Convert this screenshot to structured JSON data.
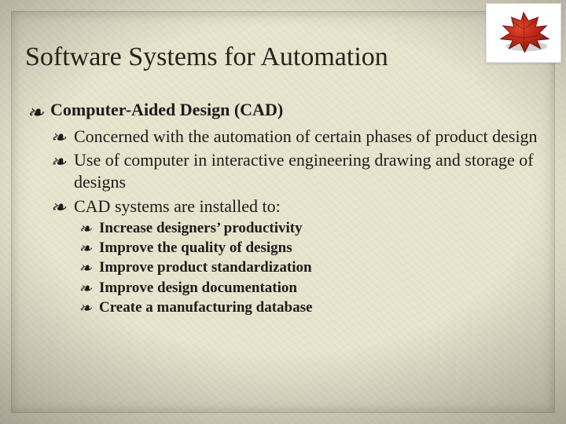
{
  "slide": {
    "title": "Software Systems for Automation",
    "decor_icon_name": "maple-leaf-icon",
    "bullets_l1": [
      {
        "text": "Computer-Aided Design (CAD)"
      }
    ],
    "bullets_l2": [
      {
        "text": "Concerned with the automation of certain phases of product design"
      },
      {
        "text": "Use of computer in interactive engineering drawing and storage of designs"
      },
      {
        "text": "CAD systems are installed to:"
      }
    ],
    "bullets_l3": [
      {
        "text": "Increase designers’ productivity"
      },
      {
        "text": "Improve the quality of designs"
      },
      {
        "text": "Improve product standardization"
      },
      {
        "text": "Improve design documentation"
      },
      {
        "text": "Create a manufacturing database"
      }
    ],
    "bullet_glyph": "❧"
  }
}
